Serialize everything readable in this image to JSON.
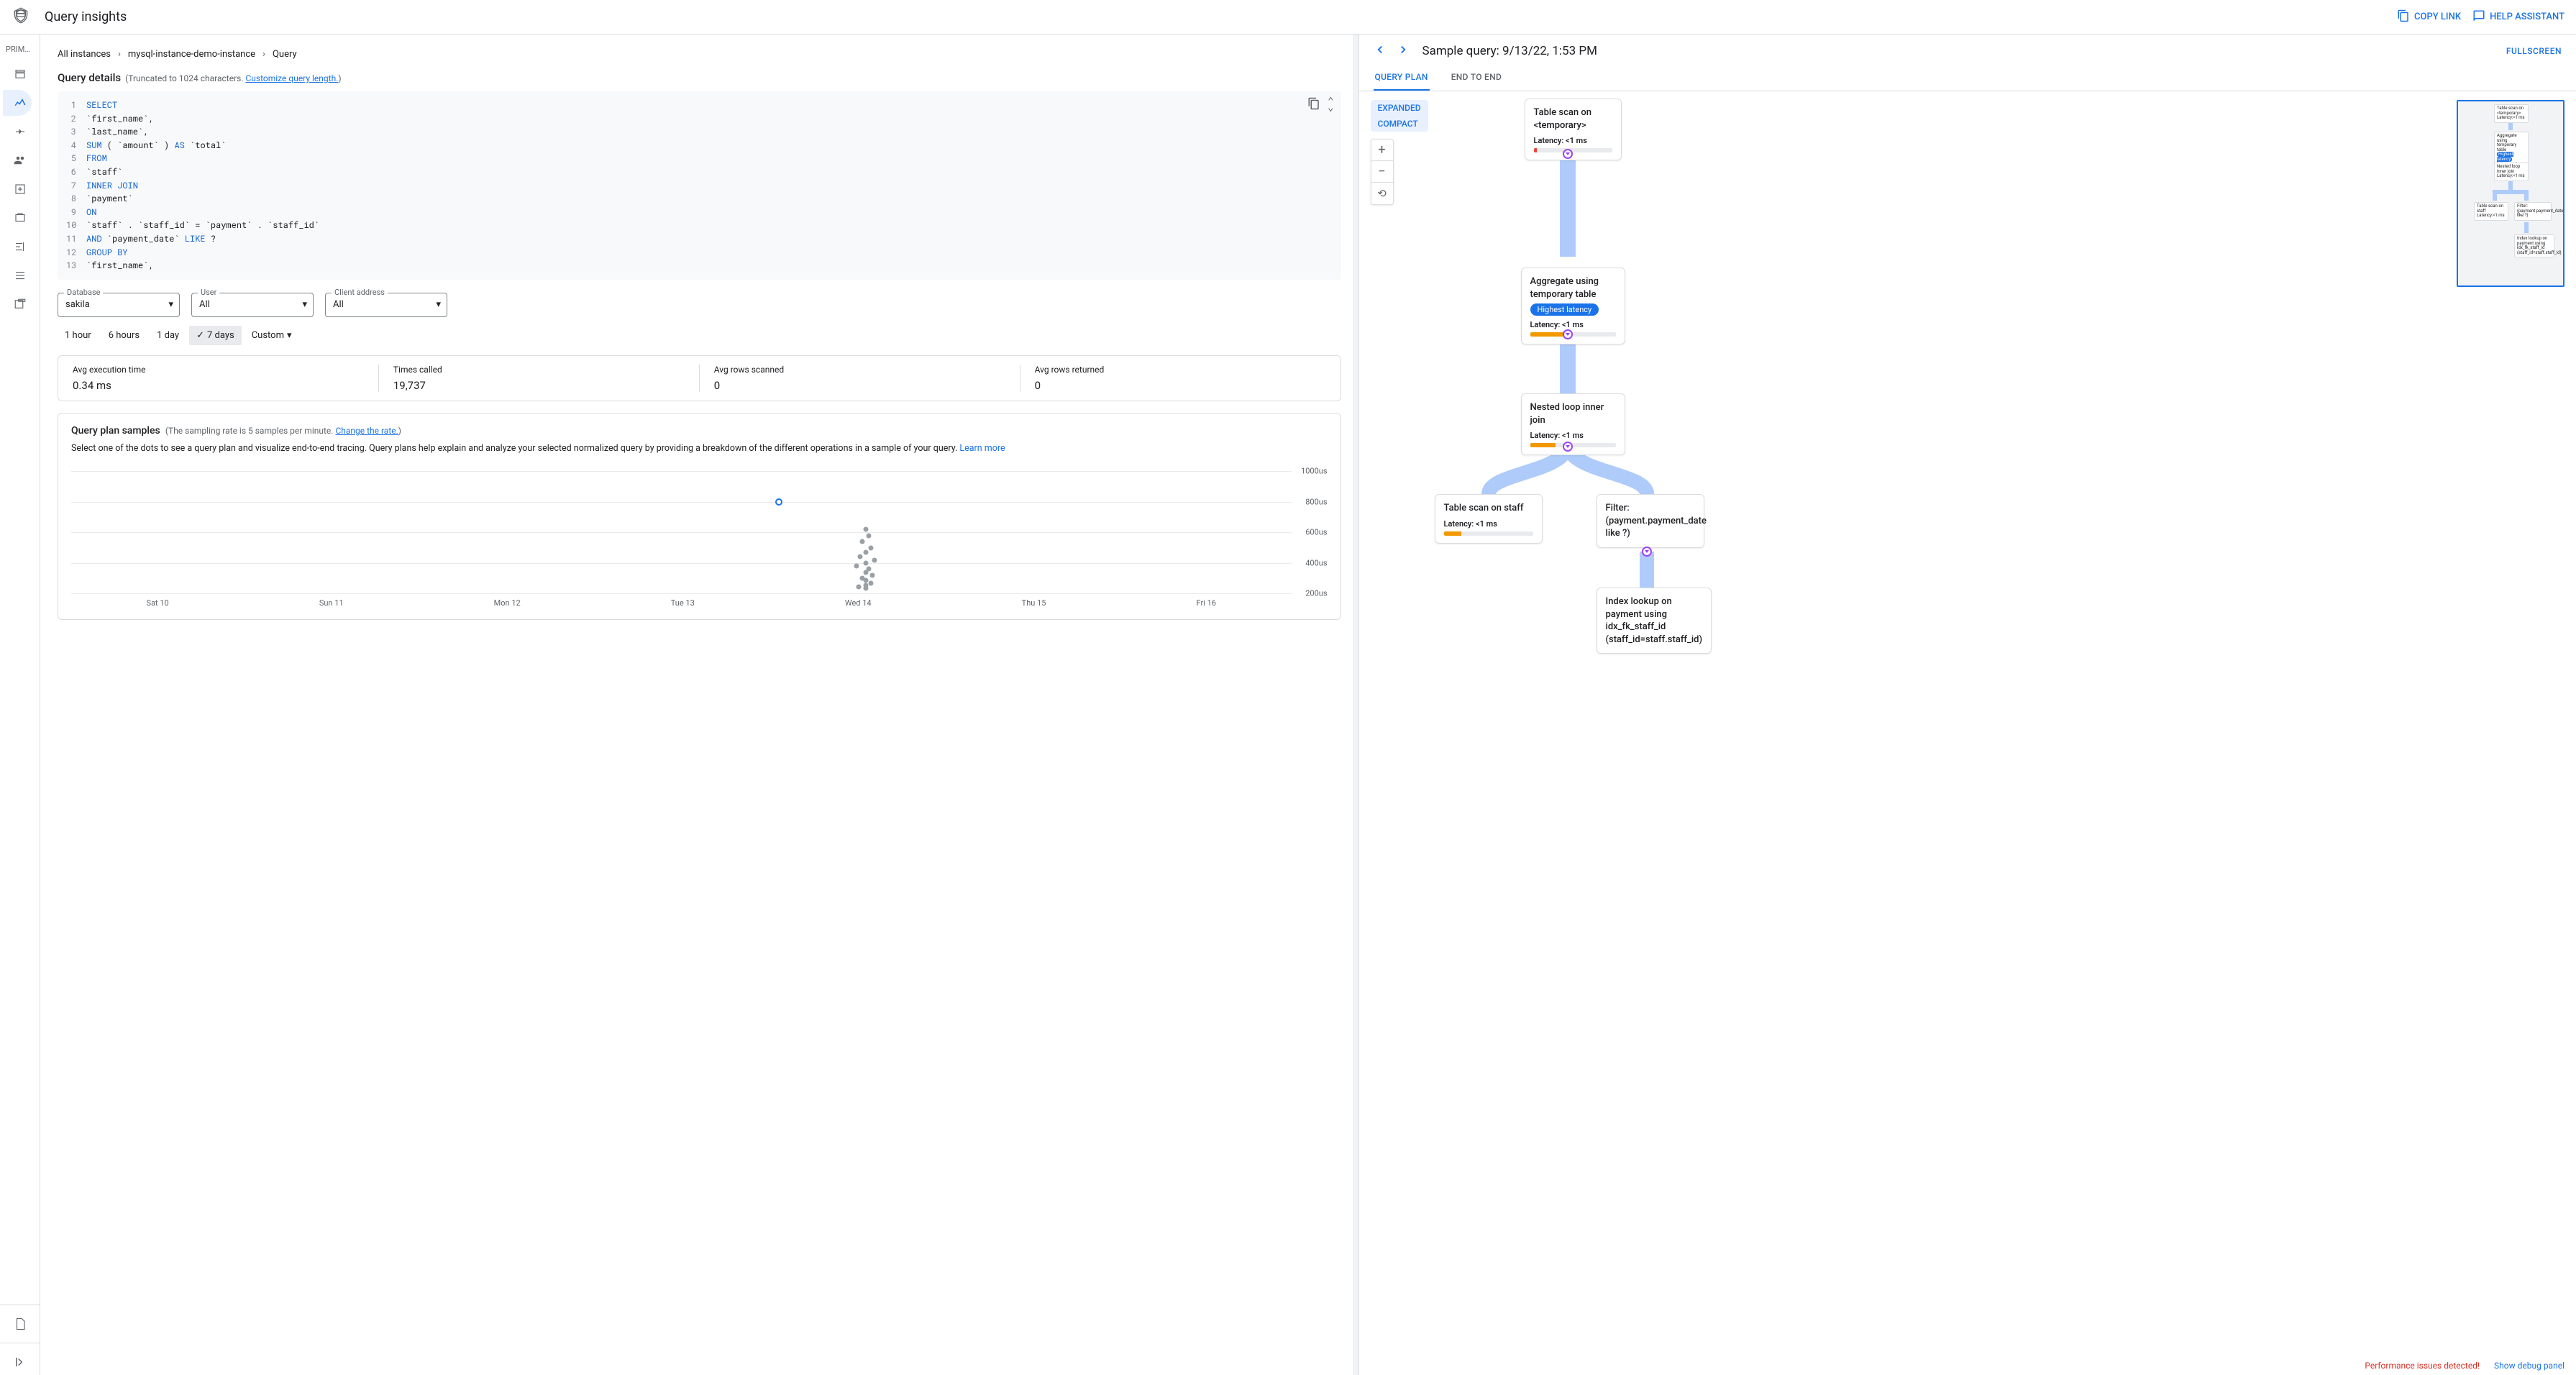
{
  "page_title": "Query insights",
  "topbar": {
    "copy_link": "COPY LINK",
    "help_assistant": "HELP ASSISTANT"
  },
  "sidebar": {
    "heading": "PRIM…"
  },
  "breadcrumb": {
    "item1": "All instances",
    "item2": "mysql-instance-demo-instance",
    "item3": "Query"
  },
  "details": {
    "title": "Query details",
    "truncated": "(Truncated to 1024 characters. ",
    "customize": "Customize query length.",
    "close_paren": ")"
  },
  "code": {
    "lines": [
      {
        "n": "1",
        "t": "SELECT",
        "cls": "kw"
      },
      {
        "n": "2",
        "t": "  `first_name`,"
      },
      {
        "n": "3",
        "t": "  `last_name`,"
      },
      {
        "n": "4",
        "t": "  SUM ( `amount` ) AS `total`",
        "mix": [
          [
            "  ",
            ""
          ],
          [
            "SUM",
            "kw"
          ],
          [
            " ( `amount` ) ",
            ""
          ],
          [
            "AS",
            "kw"
          ],
          [
            " `total`",
            ""
          ]
        ]
      },
      {
        "n": "5",
        "t": "FROM",
        "cls": "kw"
      },
      {
        "n": "6",
        "t": "  `staff`"
      },
      {
        "n": "7",
        "t": "INNER JOIN",
        "cls": "kw"
      },
      {
        "n": "8",
        "t": "  `payment`"
      },
      {
        "n": "9",
        "t": "ON",
        "cls": "kw"
      },
      {
        "n": "10",
        "t": "  `staff` . `staff_id` = `payment` . `staff_id`"
      },
      {
        "n": "11",
        "t": "  AND `payment_date` LIKE ?",
        "mix": [
          [
            "  ",
            ""
          ],
          [
            "AND",
            "kw"
          ],
          [
            " `payment_date` ",
            ""
          ],
          [
            "LIKE",
            "kw"
          ],
          [
            " ?",
            ""
          ]
        ]
      },
      {
        "n": "12",
        "t": "GROUP BY",
        "cls": "kw"
      },
      {
        "n": "13",
        "t": "  `first_name`,"
      }
    ]
  },
  "filters": {
    "database": {
      "label": "Database",
      "value": "sakila"
    },
    "user": {
      "label": "User",
      "value": "All"
    },
    "client": {
      "label": "Client address",
      "value": "All"
    }
  },
  "timerange": {
    "h1": "1 hour",
    "h6": "6 hours",
    "d1": "1 day",
    "d7": "7 days",
    "custom": "Custom"
  },
  "stats": {
    "exec_label": "Avg execution time",
    "exec_value": "0.34 ms",
    "times_label": "Times called",
    "times_value": "19,737",
    "scanned_label": "Avg rows scanned",
    "scanned_value": "0",
    "returned_label": "Avg rows returned",
    "returned_value": "0"
  },
  "samples": {
    "title": "Query plan samples",
    "sub": "(The sampling rate is 5 samples per minute. ",
    "change": "Change the rate.",
    "close": ")",
    "desc": "Select one of the dots to see a query plan and visualize end-to-end tracing. Query plans help explain and analyze your selected normalized query by providing a breakdown of the different operations in a sample of your query. ",
    "learn": "Learn more"
  },
  "chart_data": {
    "type": "scatter",
    "ylabel": "",
    "y_unit": "us",
    "ylim": [
      200,
      1000
    ],
    "y_ticks": [
      "1000us",
      "800us",
      "600us",
      "400us",
      "200us"
    ],
    "categories": [
      "Sat 10",
      "Sun 11",
      "Mon 12",
      "Tue 13",
      "Wed 14",
      "Thu 15",
      "Fri 16"
    ],
    "selected": {
      "x": 3.5,
      "y": 800
    },
    "points": [
      {
        "x": 3.5,
        "y": 800,
        "selected": true
      },
      {
        "x": 4.0,
        "y": 620
      },
      {
        "x": 4.02,
        "y": 580
      },
      {
        "x": 3.98,
        "y": 540
      },
      {
        "x": 4.03,
        "y": 500
      },
      {
        "x": 4.0,
        "y": 470
      },
      {
        "x": 3.97,
        "y": 440
      },
      {
        "x": 4.05,
        "y": 420
      },
      {
        "x": 4.0,
        "y": 400
      },
      {
        "x": 3.95,
        "y": 380
      },
      {
        "x": 4.02,
        "y": 360
      },
      {
        "x": 4.0,
        "y": 340
      },
      {
        "x": 4.04,
        "y": 320
      },
      {
        "x": 3.98,
        "y": 300
      },
      {
        "x": 4.0,
        "y": 285
      },
      {
        "x": 4.03,
        "y": 270
      },
      {
        "x": 4.0,
        "y": 255
      },
      {
        "x": 3.96,
        "y": 245
      },
      {
        "x": 4.0,
        "y": 235
      }
    ]
  },
  "right": {
    "title": "Sample query: 9/13/22, 1:53 PM",
    "fullscreen": "FULLSCREEN",
    "tab_plan": "QUERY PLAN",
    "tab_e2e": "END TO END",
    "expanded": "EXPANDED",
    "compact": "COMPACT"
  },
  "plan": {
    "n1": {
      "title": "Table scan on <temporary>",
      "lat": "Latency: <1 ms"
    },
    "n2": {
      "title": "Aggregate using temporary table",
      "badge": "Highest latency",
      "lat": "Latency: <1 ms"
    },
    "n3": {
      "title": "Nested loop inner join",
      "lat": "Latency: <1 ms"
    },
    "n4": {
      "title": "Table scan on staff",
      "lat": "Latency: <1 ms"
    },
    "n5": {
      "title": "Filter: (payment.payment_date like ?)"
    },
    "n6": {
      "title": "Index lookup on payment using idx_fk_staff_id (staff_id=staff.staff_id)"
    }
  },
  "footer": {
    "alert": "Performance issues detected!",
    "debug": "Show debug panel"
  }
}
